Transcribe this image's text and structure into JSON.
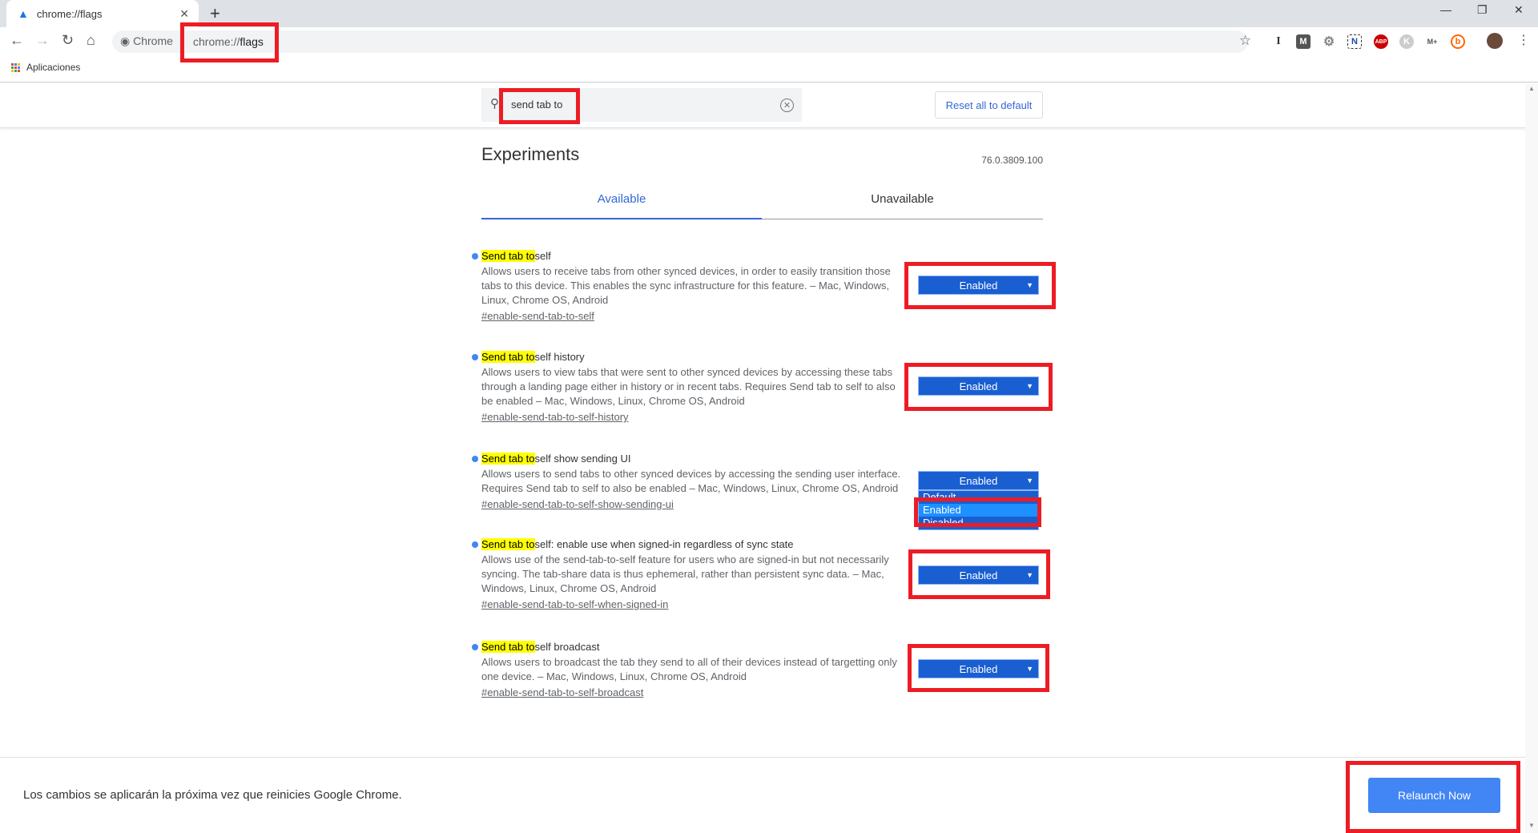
{
  "browser": {
    "tab_title": "chrome://flags",
    "omnibox_chip": "Chrome",
    "url_prefix": "chrome://",
    "url_path": "flags",
    "bookmarks": [
      {
        "label": "Aplicaciones"
      }
    ],
    "extensions": [
      "I",
      "M",
      "gear",
      "N",
      "ABP",
      "K",
      "M+",
      "b"
    ]
  },
  "search": {
    "value": "send tab to"
  },
  "reset_label": "Reset all to default",
  "title": "Experiments",
  "version": "76.0.3809.100",
  "tabs": [
    {
      "label": "Available",
      "active": true
    },
    {
      "label": "Unavailable",
      "active": false
    }
  ],
  "experiments": [
    {
      "highlight": "Send tab to",
      "title": " self",
      "desc": "Allows users to receive tabs from other synced devices, in order to easily transition those tabs to this device. This enables the sync infrastructure for this feature. – Mac, Windows, Linux, Chrome OS, Android",
      "link": "#enable-send-tab-to-self",
      "value": "Enabled"
    },
    {
      "highlight": "Send tab to",
      "title": " self history",
      "desc": "Allows users to view tabs that were sent to other synced devices by accessing these tabs through a landing page either in history or in recent tabs. Requires Send tab to self to also be enabled – Mac, Windows, Linux, Chrome OS, Android",
      "link": "#enable-send-tab-to-self-history",
      "value": "Enabled"
    },
    {
      "highlight": "Send tab to",
      "title": " self show sending UI",
      "desc": "Allows users to send tabs to other synced devices by accessing the sending user interface. Requires Send tab to self to also be enabled – Mac, Windows, Linux, Chrome OS, Android",
      "link": "#enable-send-tab-to-self-show-sending-ui",
      "value": "Enabled"
    },
    {
      "highlight": "Send tab to",
      "title": " self: enable use when signed-in regardless of sync state",
      "desc": "Allows use of the send-tab-to-self feature for users who are signed-in but not necessarily syncing. The tab-share data is thus ephemeral, rather than persistent sync data. – Mac, Windows, Linux, Chrome OS, Android",
      "link": "#enable-send-tab-to-self-when-signed-in",
      "value": "Enabled"
    },
    {
      "highlight": "Send tab to",
      "title": " self broadcast",
      "desc": "Allows users to broadcast the tab they send to all of their devices instead of targetting only one device. – Mac, Windows, Linux, Chrome OS, Android",
      "link": "#enable-send-tab-to-self-broadcast",
      "value": "Enabled"
    }
  ],
  "dropdown_options": [
    "Default",
    "Enabled",
    "Disabled"
  ],
  "footer": {
    "notice": "Los cambios se aplicarán la próxima vez que reinicies Google Chrome.",
    "relaunch_label": "Relaunch Now"
  },
  "colors": {
    "accent": "#4285f4",
    "annotation": "#ed1c24",
    "highlight": "#ffff00"
  }
}
